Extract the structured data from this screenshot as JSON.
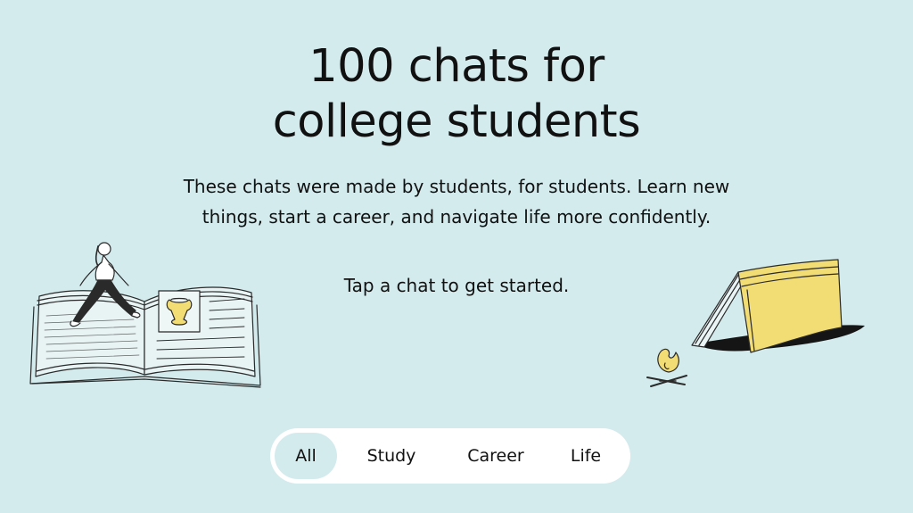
{
  "hero": {
    "title_line1": "100 chats for",
    "title_line2": "college students",
    "description_line1": "These chats were made by students, for students. Learn new",
    "description_line2": "things, start a career, and navigate life more confidently.",
    "cta": "Tap a chat to get started."
  },
  "filters": {
    "tabs": [
      {
        "label": "All",
        "active": true
      },
      {
        "label": "Study",
        "active": false
      },
      {
        "label": "Career",
        "active": false
      },
      {
        "label": "Life",
        "active": false
      }
    ]
  },
  "illustrations": {
    "left": "open-book-walking-student-icon",
    "right": "book-tent-campfire-icon"
  },
  "colors": {
    "background": "#d4ebee",
    "accent_yellow": "#f2dc74",
    "tab_bar": "#ffffff",
    "active_tab": "#d4ebee",
    "text": "#111111"
  }
}
